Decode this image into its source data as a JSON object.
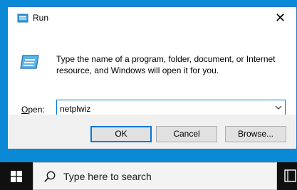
{
  "dialog": {
    "title": "Run",
    "description": "Type the name of a program, folder, document, or Internet resource, and Windows will open it for you.",
    "open_label_mnemonic": "O",
    "open_label_rest": "pen:",
    "open_value": "netplwiz",
    "buttons": {
      "ok": "OK",
      "cancel": "Cancel",
      "browse": "Browse..."
    },
    "close_glyph": "✕"
  },
  "taskbar": {
    "search_placeholder": "Type here to search"
  },
  "colors": {
    "desktop": "#0a8ad6",
    "accent": "#0078d7",
    "taskbar": "#101010"
  }
}
